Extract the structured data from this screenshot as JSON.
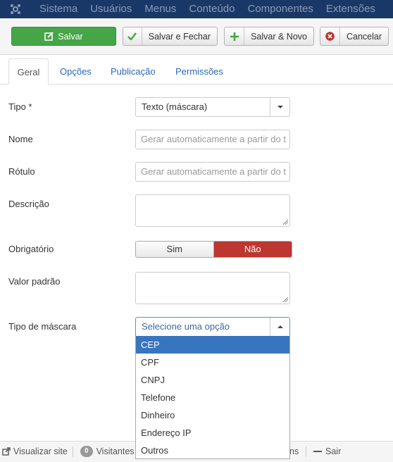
{
  "topbar": {
    "menu": [
      "Sistema",
      "Usuários",
      "Menus",
      "Conteúdo",
      "Componentes",
      "Extensões"
    ]
  },
  "toolbar": {
    "save": "Salvar",
    "save_close": "Salvar e Fechar",
    "save_new": "Salvar & Novo",
    "cancel": "Cancelar"
  },
  "tabs": [
    "Geral",
    "Opções",
    "Publicação",
    "Permissões"
  ],
  "form": {
    "type_label": "Tipo *",
    "type_value": "Texto (máscara)",
    "name_label": "Nome",
    "name_placeholder": "Gerar automaticamente a partir do t",
    "label_label": "Rótulo",
    "label_placeholder": "Gerar automaticamente a partir do t",
    "description_label": "Descrição",
    "required_label": "Obrigatório",
    "required_yes": "Sim",
    "required_no": "Não",
    "default_label": "Valor padrão",
    "mask_label": "Tipo de máscara",
    "mask_placeholder": "Selecione uma opção",
    "mask_options": [
      "CEP",
      "CPF",
      "CNPJ",
      "Telefone",
      "Dinheiro",
      "Endereço IP",
      "Outros"
    ]
  },
  "statusbar": {
    "view_site": "Visualizar site",
    "visitors_count": "0",
    "visitors_label": "Visitantes",
    "admins_fragment": "ns",
    "logout": "Sair"
  },
  "colors": {
    "topbar": "#1a3867",
    "save_button": "#46a546",
    "toggle_no": "#bd362f",
    "selected_option": "#3875c0",
    "tab_link": "#2a69b8"
  }
}
